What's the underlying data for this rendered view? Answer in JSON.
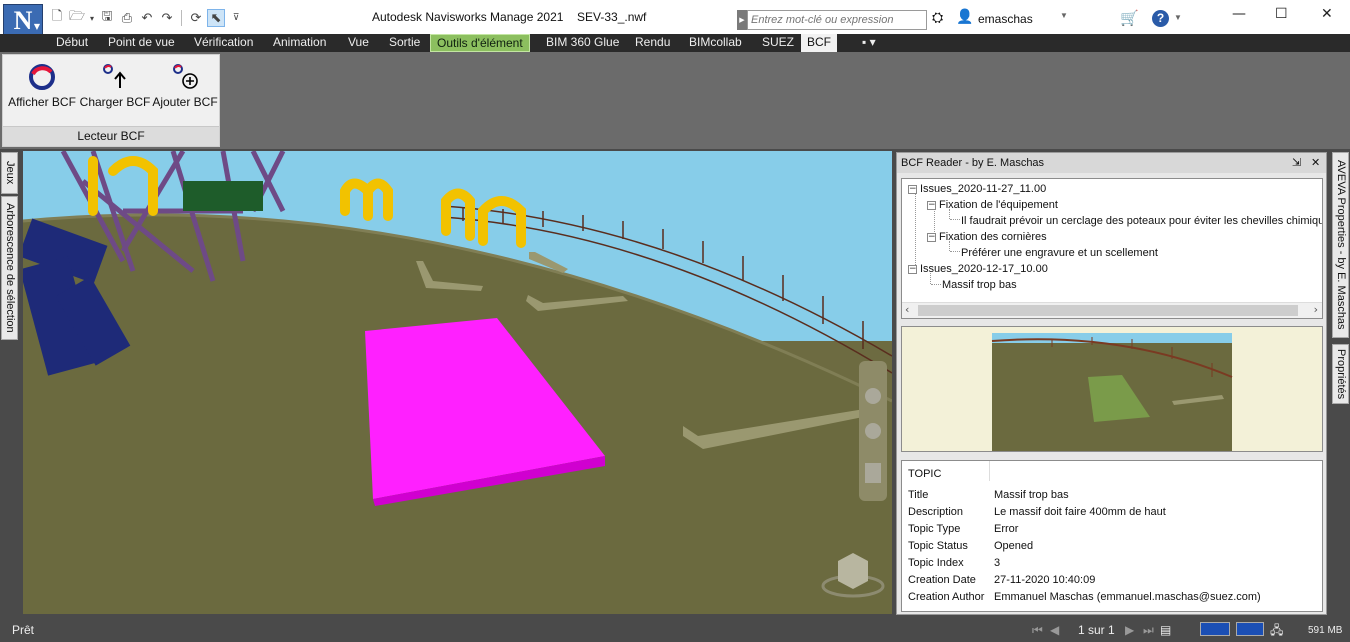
{
  "app": {
    "logo_letter": "N",
    "title": "Autodesk Navisworks Manage 2021",
    "file": "SEV-33_.nwf"
  },
  "search": {
    "placeholder": "Entrez mot-clé ou expression"
  },
  "user": {
    "name": "emaschas"
  },
  "help_label": "?",
  "window": {
    "minimize": "—",
    "maximize": "☐",
    "close": "✕"
  },
  "tabs": [
    {
      "label": "Début"
    },
    {
      "label": "Point de vue"
    },
    {
      "label": "Vérification"
    },
    {
      "label": "Animation"
    },
    {
      "label": "Vue"
    },
    {
      "label": "Sortie"
    },
    {
      "label": "Outils d'élément"
    },
    {
      "label": "BIM 360 Glue"
    },
    {
      "label": "Rendu"
    },
    {
      "label": "BIMcollab"
    },
    {
      "label": "SUEZ"
    },
    {
      "label": "BCF"
    },
    {
      "label": "▪ ▾"
    }
  ],
  "ribbon": {
    "buttons": [
      {
        "label": "Afficher BCF"
      },
      {
        "label": "Charger BCF"
      },
      {
        "label": "Ajouter BCF"
      }
    ],
    "panel_label": "Lecteur BCF"
  },
  "side_tabs": {
    "left": [
      "Jeux",
      "Arborescence de sélection"
    ],
    "right": [
      "AVEVA Properties - by E. Maschas",
      "Propriétés"
    ]
  },
  "bcf": {
    "header": "BCF Reader - by E. Maschas",
    "tree": [
      "Issues_2020-11-27_11.00",
      "Fixation de l'équipement",
      "Il faudrait prévoir un cerclage des poteaux pour éviter les chevilles chimiqu",
      "Fixation des cornières",
      "Préférer une engravure et un scellement",
      "Issues_2020-12-17_10.00",
      "Massif trop bas"
    ],
    "props": {
      "section": "TOPIC",
      "rows": [
        {
          "key": "Title",
          "value": "Massif trop bas"
        },
        {
          "key": "Description",
          "value": "Le massif doit faire 400mm de haut"
        },
        {
          "key": "Topic Type",
          "value": "Error"
        },
        {
          "key": "Topic Status",
          "value": "Opened"
        },
        {
          "key": "Topic Index",
          "value": "3"
        },
        {
          "key": "Creation Date",
          "value": "27-11-2020 10:40:09"
        },
        {
          "key": "Creation Author",
          "value": "Emmanuel Maschas (emmanuel.maschas@suez.com)"
        }
      ]
    }
  },
  "status": {
    "ready": "Prêt",
    "page": "1 sur 1",
    "memory": "591 MB"
  },
  "colors": {
    "accent": "#3b6bb3",
    "active_tab_green": "#8cbf5f",
    "highlight_magenta": "#ff00ff",
    "floor": "#6b6a3f",
    "sky": "#87cde9"
  }
}
